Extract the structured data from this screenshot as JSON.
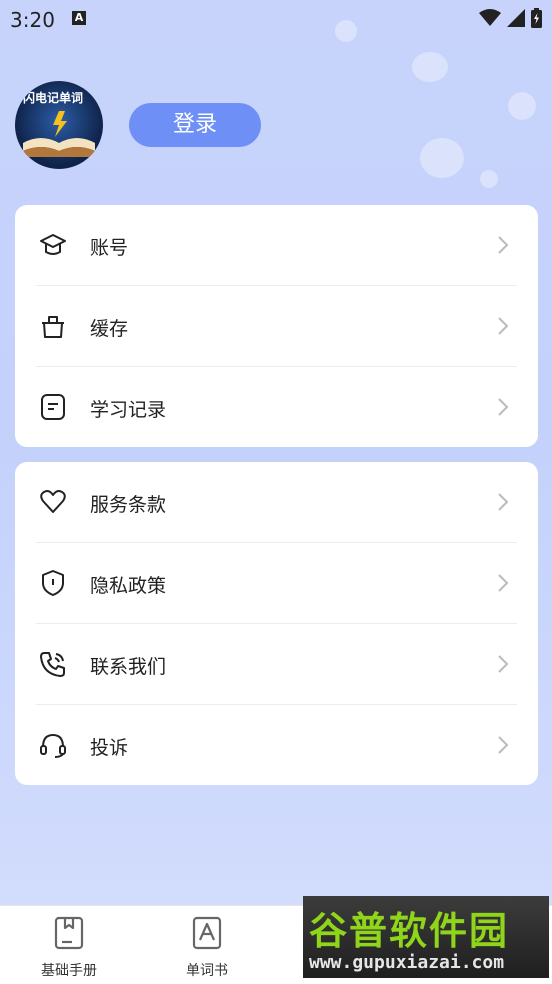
{
  "status_bar": {
    "time": "3:20",
    "notification_letter": "A"
  },
  "profile": {
    "avatar_text": "闪电记单词",
    "login_label": "登录"
  },
  "menu_group_1": [
    {
      "label": "账号",
      "icon": "graduation-cap-icon"
    },
    {
      "label": "缓存",
      "icon": "trash-icon"
    },
    {
      "label": "学习记录",
      "icon": "document-icon"
    }
  ],
  "menu_group_2": [
    {
      "label": "服务条款",
      "icon": "heart-icon"
    },
    {
      "label": "隐私政策",
      "icon": "shield-icon"
    },
    {
      "label": "联系我们",
      "icon": "phone-icon"
    },
    {
      "label": "投诉",
      "icon": "headset-icon"
    }
  ],
  "bottom_nav": [
    {
      "label": "基础手册",
      "icon": "book-icon"
    },
    {
      "label": "单词书",
      "icon": "letter-a-book-icon"
    }
  ],
  "watermark": {
    "title": "谷普软件园",
    "url": "www.gupuxiazai.com"
  },
  "colors": {
    "accent": "#6e8ff6",
    "background": "#c6d3fb",
    "watermark_green": "#8fd61a"
  }
}
